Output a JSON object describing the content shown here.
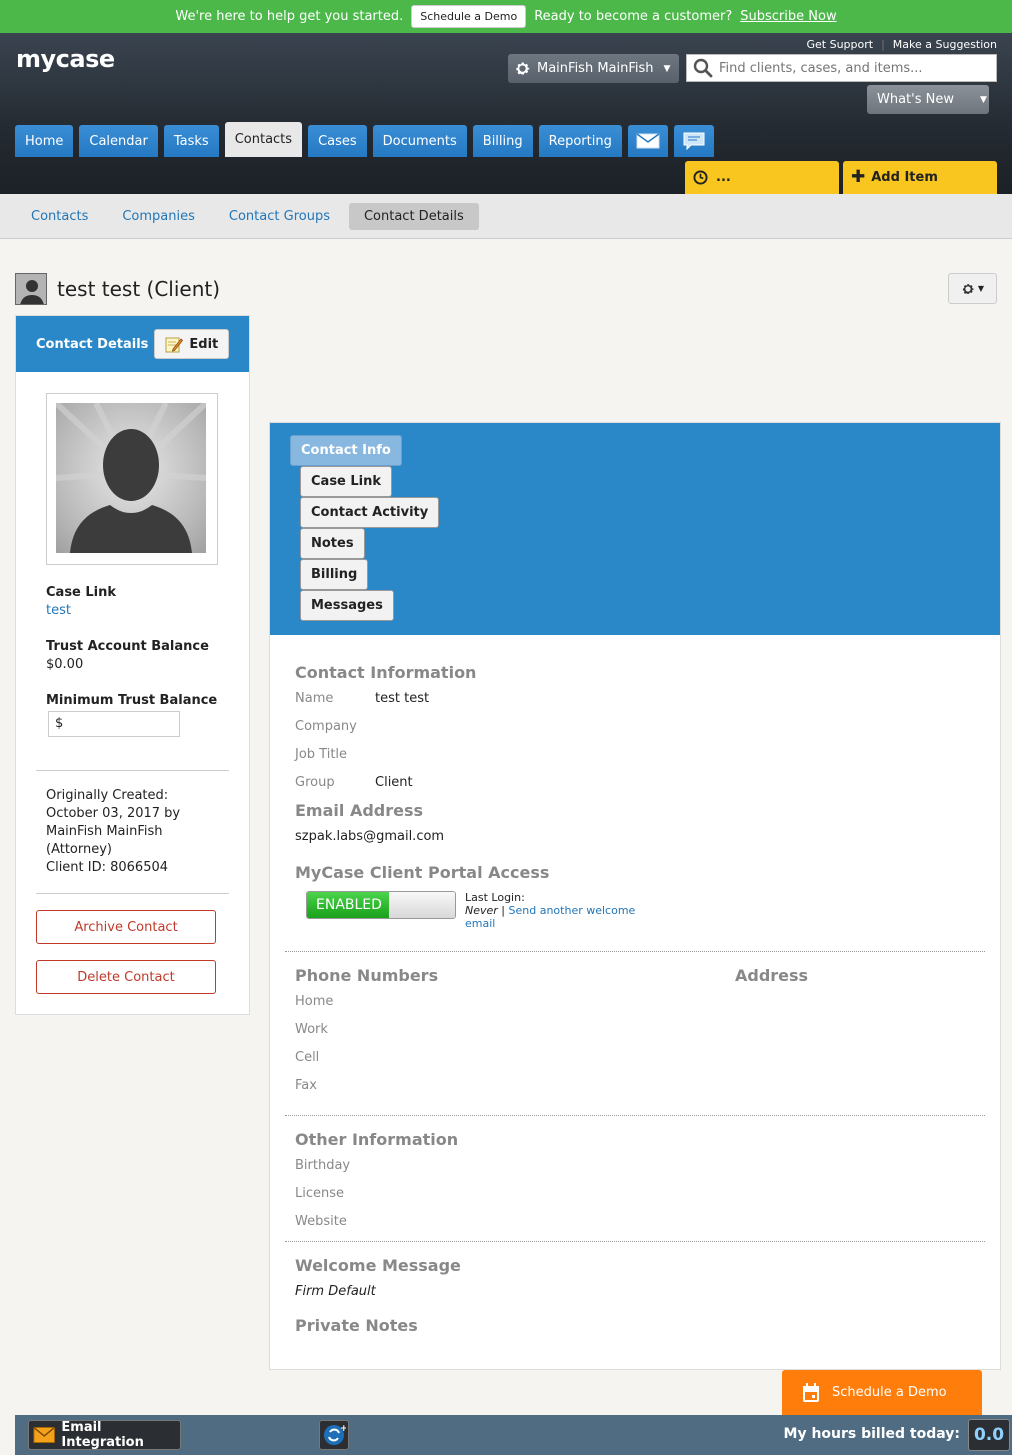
{
  "promo": {
    "text": "We're here to help get you started.",
    "demo_button": "Schedule a Demo",
    "text2": "Ready to become a customer?",
    "subscribe_link": "Subscribe Now"
  },
  "header": {
    "logo": "mycase",
    "get_support": "Get Support",
    "separator": "|",
    "make_suggestion": "Make a Suggestion",
    "user_name": "MainFish MainFish",
    "search_placeholder": "Find clients, cases, and items...",
    "whats_new": "What's New",
    "timer_label": "...",
    "add_item": "Add Item"
  },
  "nav": {
    "tabs": [
      "Home",
      "Calendar",
      "Tasks",
      "Contacts",
      "Cases",
      "Documents",
      "Billing",
      "Reporting"
    ],
    "active": "Contacts"
  },
  "subnav": {
    "tabs": [
      "Contacts",
      "Companies",
      "Contact Groups",
      "Contact Details"
    ],
    "active": "Contact Details"
  },
  "page": {
    "title": "test test (Client)"
  },
  "left": {
    "header_title": "Contact Details",
    "edit_label": "Edit",
    "case_link_label": "Case Link",
    "case_link_value": "test",
    "trust_label": "Trust Account Balance",
    "trust_value": "$0.00",
    "min_trust_label": "Minimum Trust Balance",
    "min_trust_value": "$",
    "created_line1": "Originally Created:",
    "created_line2": "October 03, 2017 by",
    "created_line3": "MainFish MainFish",
    "created_line4": "(Attorney)",
    "client_id": "Client ID: 8066504",
    "archive_label": "Archive Contact",
    "delete_label": "Delete Contact"
  },
  "panel": {
    "tabs": [
      "Contact Info",
      "Case Link",
      "Contact Activity",
      "Notes",
      "Billing",
      "Messages"
    ],
    "active": "Contact Info",
    "contact_info_title": "Contact Information",
    "name_label": "Name",
    "name_value": "test test",
    "company_label": "Company",
    "job_label": "Job Title",
    "group_label": "Group",
    "group_value": "Client",
    "email_title": "Email Address",
    "email_value": "szpak.labs@gmail.com",
    "portal_title": "MyCase Client Portal Access",
    "portal_toggle": "ENABLED",
    "last_login_label": "Last Login:",
    "last_login_value": "Never",
    "last_login_sep": "|",
    "welcome_link": "Send another welcome email",
    "phone_title": "Phone Numbers",
    "address_title": "Address",
    "home_label": "Home",
    "work_label": "Work",
    "cell_label": "Cell",
    "fax_label": "Fax",
    "other_title": "Other Information",
    "birthday_label": "Birthday",
    "license_label": "License",
    "website_label": "Website",
    "welcome_title": "Welcome Message",
    "welcome_value": "Firm Default",
    "private_title": "Private Notes"
  },
  "footer": {
    "schedule_demo": "Schedule a Demo",
    "email_integration": "Email Integration",
    "hours_label": "My hours billed today:",
    "hours_value": "0.0"
  }
}
